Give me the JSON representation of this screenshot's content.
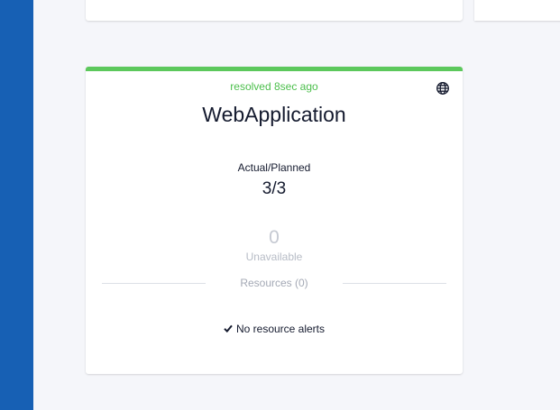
{
  "card": {
    "status_text": "resolved 8sec ago",
    "title": "WebApplication",
    "actual_planned_label": "Actual/Planned",
    "actual_planned_value": "3/3",
    "unavailable_count": "0",
    "unavailable_label": "Unavailable",
    "resources_label": "Resources (0)",
    "alerts_text": "No resource alerts",
    "alerts_icon": "checkmark-icon",
    "scope_icon": "globe-icon"
  },
  "colors": {
    "sidebar": "#1760b4",
    "status_ok": "#5cc85c",
    "resolved_text": "#4cbf4c",
    "background": "#f5f6fa"
  }
}
